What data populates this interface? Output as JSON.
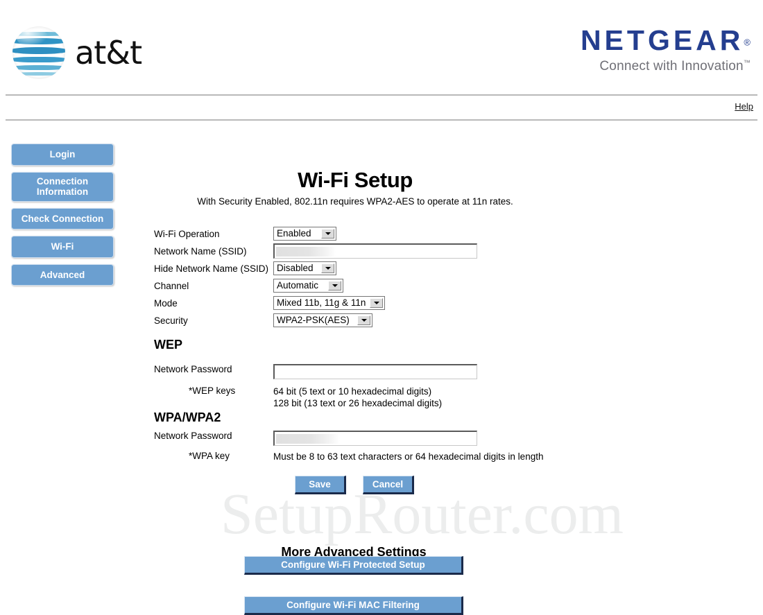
{
  "header": {
    "att_brand": "at&t",
    "att_globe_icon": "att-globe-icon",
    "netgear_brand": "NETGEAR",
    "netgear_registered": "®",
    "netgear_tagline": "Connect with Innovation",
    "netgear_tm": "™",
    "help_link": "Help"
  },
  "sidebar": {
    "items": [
      {
        "label": "Login",
        "two_line": false
      },
      {
        "label": "Connection\nInformation",
        "line1": "Connection",
        "line2": "Information",
        "two_line": true
      },
      {
        "label": "Check Connection",
        "two_line": false
      },
      {
        "label": "Wi-Fi",
        "two_line": false
      },
      {
        "label": "Advanced",
        "two_line": false
      }
    ]
  },
  "main": {
    "title": "Wi-Fi Setup",
    "subtitle": "With Security Enabled, 802.11n requires WPA2-AES to operate at 11n rates.",
    "fields": [
      {
        "label": "Wi-Fi Operation",
        "type": "select",
        "value": "Enabled"
      },
      {
        "label": "Network Name (SSID)",
        "type": "text",
        "value": "",
        "redacted": true
      },
      {
        "label": "Hide Network Name (SSID)",
        "type": "select",
        "value": "Disabled"
      },
      {
        "label": "Channel",
        "type": "select",
        "value": "Automatic"
      },
      {
        "label": "Mode",
        "type": "select",
        "value": "Mixed 11b, 11g & 11n"
      },
      {
        "label": "Security",
        "type": "select",
        "value": "WPA2-PSK(AES)"
      }
    ],
    "wep": {
      "heading": "WEP",
      "password_label": "Network Password",
      "password_value": "",
      "keys_label": "*WEP keys",
      "keys_line1": "64 bit (5 text or 10 hexadecimal digits)",
      "keys_line2": "128 bit (13 text or 26 hexadecimal digits)"
    },
    "wpa": {
      "heading": "WPA/WPA2",
      "password_label": "Network Password",
      "password_value": "",
      "key_label": "*WPA key",
      "key_help": "Must be 8 to 63 text characters or 64 hexadecimal digits in length"
    },
    "actions": {
      "save_label": "Save",
      "cancel_label": "Cancel"
    },
    "more": {
      "heading": "More Advanced Settings",
      "wps_button": "Configure Wi-Fi Protected Setup",
      "mac_button": "Configure Wi-Fi MAC Filtering"
    }
  },
  "watermark": {
    "text": "SetupRouter.com"
  },
  "colors": {
    "button_blue": "#6b9fd0",
    "netgear_blue": "#243e8f",
    "att_blue": "#2f93c4",
    "rule_gray": "#b9b9b9",
    "watermark_gray": "#eceded"
  }
}
